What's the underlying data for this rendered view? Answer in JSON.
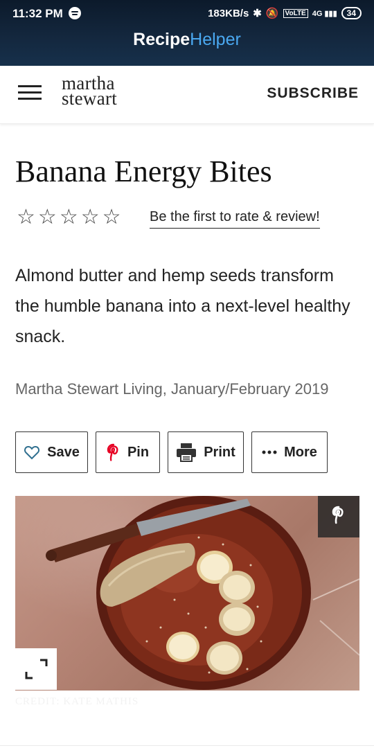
{
  "status_bar": {
    "time": "11:32 PM",
    "speed": "183KB/s",
    "network": "4G",
    "battery": "34"
  },
  "app_header": {
    "brand_part1": "Recipe",
    "brand_part2": "Helper",
    "brand_accent": "#4aa8f0"
  },
  "site_header": {
    "logo_line1": "martha",
    "logo_line2": "stewart",
    "subscribe_label": "SUBSCRIBE"
  },
  "recipe": {
    "title": "Banana Energy Bites",
    "rating_stars": 0,
    "rating_max": 5,
    "rate_link": "Be the first to rate & review!",
    "description": "Almond butter and hemp seeds transform the humble banana into a next-level healthy snack.",
    "source": "Martha Stewart Living, January/February 2019"
  },
  "actions": {
    "save_label": "Save",
    "pin_label": "Pin",
    "print_label": "Print",
    "more_label": "More",
    "pin_color": "#e60023"
  },
  "image": {
    "credit": "CREDIT: KATE MATHIS"
  }
}
